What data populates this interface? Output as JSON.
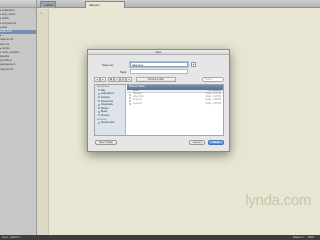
{
  "sidebar": {
    "items": [
      {
        "label": "▾ exploration",
        "selected": false
      },
      {
        "label": "  ▸ auto_cache",
        "selected": false
      },
      {
        "label": "  ▸ builds",
        "selected": false
      },
      {
        "label": "  ▾ components",
        "selected": false
      },
      {
        "label": "    ▸ auto",
        "selected": false
      },
      {
        "label": "      index.html",
        "selected": true
      },
      {
        "label": "    ▸ ...",
        "selected": false
      },
      {
        "label": "      readme.md",
        "selected": false
      },
      {
        "label": "      tiles.css",
        "selected": false
      },
      {
        "label": "    ▸ scripts",
        "selected": false
      },
      {
        "label": "  ▾ node_modules",
        "selected": false
      },
      {
        "label": "    playlists",
        "selected": false
      },
      {
        "label": "    gruntfile.js",
        "selected": false
      },
      {
        "label": "    package.json",
        "selected": false
      },
      {
        "label": "    readme.md",
        "selected": false
      }
    ]
  },
  "tabs": [
    {
      "label": "▸ tabs.js",
      "active": false
    },
    {
      "label": "data.json",
      "active": true
    }
  ],
  "editor": {
    "first_line": "1"
  },
  "dialog": {
    "title": "Save",
    "save_as_label": "Save As:",
    "save_as_value": "data.json",
    "tags_label": "Tags:",
    "tags_value": "",
    "expand_glyph": "▴",
    "toolbar": {
      "back": "◂",
      "forward": "▸",
      "view_icons": "▦",
      "view_list": "≡",
      "view_columns": "▥",
      "view_coverflow": "▭",
      "location": "Shared Folder",
      "search_placeholder": "Search"
    },
    "sidebar": {
      "sections": [
        {
          "title": "FAVORITES",
          "items": [
            "Ray",
            "Applications",
            "Desktop",
            "Documents",
            "Downloads",
            "Movies",
            "Music",
            "Pictures"
          ]
        },
        {
          "title": "DEVICES",
          "items": [
            "Remote Disc"
          ]
        }
      ]
    },
    "location_bar": "Shared Folder",
    "columns": {
      "name": "Name",
      "date": "Date Modified"
    },
    "files": [
      {
        "name": "data.json",
        "date": "Today, 1:18 PM"
      },
      {
        "name": "index.html",
        "date": "Today, 1:18 PM"
      },
      {
        "name": "scripts.js",
        "date": "Today, 1:18 PM"
      },
      {
        "name": "style.css",
        "date": "Today, 1:18 PM"
      }
    ],
    "new_folder_label": "New Folder",
    "cancel_label": "Cancel",
    "save_label": "Save"
  },
  "statusbar": {
    "position": "Line 1, Column 1",
    "spaces": "Spaces: 2",
    "syntax": "JSON"
  },
  "watermark": "lynda.com",
  "colors": {
    "selection": "#6f8fb3",
    "primary_button": "#4f8fd8",
    "editor_bg": "#e8e6d3"
  }
}
